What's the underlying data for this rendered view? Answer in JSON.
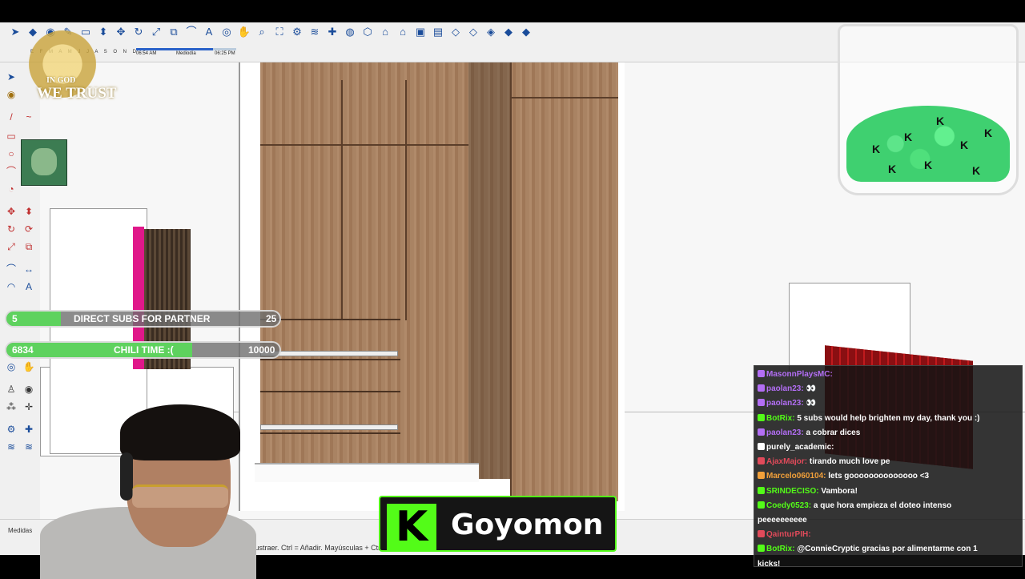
{
  "toolbar": {
    "timeline": {
      "months": "E F M A M J J A S O N D",
      "start": "06:54 AM",
      "mid": "Mediodía",
      "end": "06:25 PM"
    }
  },
  "overlay": {
    "emblem_line1": "IN GOD",
    "emblem_line2": "WE TRUST"
  },
  "goals": [
    {
      "left_value": "5",
      "label": "DIRECT SUBS FOR PARTNER",
      "right_value": "25",
      "progress": 0.2
    },
    {
      "left_value": "6834",
      "label": "CHILI TIME :(",
      "right_value": "10000",
      "progress": 0.68
    }
  ],
  "status": {
    "measure_label": "Medidas",
    "hint": "Añadir/Sustraer. Ctrl = Añadir. Mayúsculas + Ctrl ="
  },
  "kick": {
    "logo": "K",
    "name": "Goyomon"
  },
  "chat": {
    "messages": [
      {
        "user": "MasonnPlaysMC:",
        "text": "",
        "color": "#b36ef5"
      },
      {
        "user": "paolan23:",
        "text": "👀",
        "color": "#b36ef5"
      },
      {
        "user": "paolan23:",
        "text": "👀",
        "color": "#b36ef5"
      },
      {
        "user": "BotRix:",
        "text": "5 subs would help brighten my day, thank you :)",
        "color": "#53fc18"
      },
      {
        "user": "paolan23:",
        "text": "a cobrar dices",
        "color": "#b36ef5"
      },
      {
        "user": "purely_academic:",
        "text": "",
        "color": "#ffffff"
      },
      {
        "user": "AjaxMajor:",
        "text": "tirando much love pe",
        "color": "#e04a5a"
      },
      {
        "user": "Marcelo060104:",
        "text": "lets goooooooooooooo <3",
        "color": "#f2a03a"
      },
      {
        "user": "SRINDECISO:",
        "text": "Vambora!",
        "color": "#53fc18"
      },
      {
        "user": "Coedy0523:",
        "text": "a que hora empieza el doteo intenso",
        "color": "#53fc18"
      },
      {
        "user": "",
        "text": "peeeeeeeeee",
        "color": "#ffffff"
      },
      {
        "user": "QainturPIH:",
        "text": "",
        "color": "#e04a5a"
      },
      {
        "user": "BotRix:",
        "text": "@ConnieCryptic gracias por alimentarme con 1",
        "color": "#53fc18"
      },
      {
        "user": "",
        "text": "kicks!",
        "color": "#ffffff"
      }
    ]
  },
  "colors": {
    "accent_green": "#53fc18",
    "goal_fill": "#5ed25e",
    "bot_green": "#53fc18"
  }
}
